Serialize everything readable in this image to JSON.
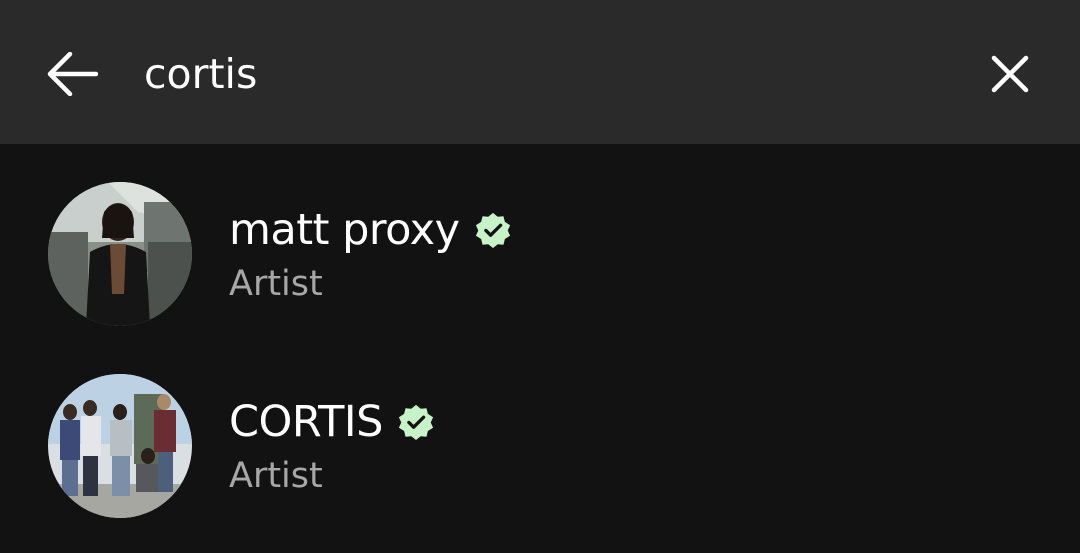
{
  "search": {
    "query": "cortis",
    "back_icon": "arrow-left-icon",
    "clear_icon": "close-icon"
  },
  "results": [
    {
      "name": "matt proxy",
      "type": "Artist",
      "verified": true,
      "verified_color": "#c8f3c8"
    },
    {
      "name": "CORTIS",
      "type": "Artist",
      "verified": true,
      "verified_color": "#c8f3c8"
    }
  ],
  "colors": {
    "background": "#121212",
    "search_bar": "#2a2a2a",
    "text_primary": "#ffffff",
    "text_secondary": "#a7a7a7"
  }
}
